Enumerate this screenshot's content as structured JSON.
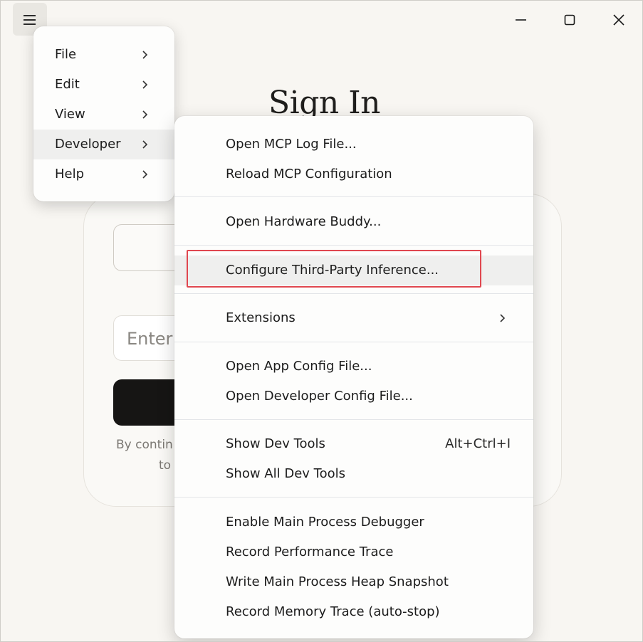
{
  "page": {
    "title": "Sign In",
    "email_placeholder": "Enter",
    "legal_line1": "By contin",
    "legal_line2": "to"
  },
  "menu": {
    "items": [
      {
        "label": "File"
      },
      {
        "label": "Edit"
      },
      {
        "label": "View"
      },
      {
        "label": "Developer",
        "active": true
      },
      {
        "label": "Help"
      }
    ]
  },
  "submenu": {
    "title": "Developer",
    "items": [
      {
        "label": "Open MCP Log File..."
      },
      {
        "label": "Reload MCP Configuration"
      },
      {
        "label": "Open Hardware Buddy..."
      },
      {
        "label": "Configure Third-Party Inference...",
        "highlighted": true
      },
      {
        "label": "Extensions",
        "has_submenu": true
      },
      {
        "label": "Open App Config File..."
      },
      {
        "label": "Open Developer Config File..."
      },
      {
        "label": "Show Dev Tools",
        "shortcut": "Alt+Ctrl+I"
      },
      {
        "label": "Show All Dev Tools"
      },
      {
        "label": "Enable Main Process Debugger"
      },
      {
        "label": "Record Performance Trace"
      },
      {
        "label": "Write Main Process Heap Snapshot"
      },
      {
        "label": "Record Memory Trace (auto-stop)"
      }
    ]
  },
  "colors": {
    "highlight_border": "#e0474f",
    "menu_active_bg": "#efefee",
    "page_bg": "#f8f6f2"
  },
  "icons": {
    "menu": "hamburger-icon",
    "minimize": "minimize-icon",
    "maximize": "maximize-icon",
    "close": "close-icon",
    "submenu_arrow": "chevron-right-icon"
  }
}
